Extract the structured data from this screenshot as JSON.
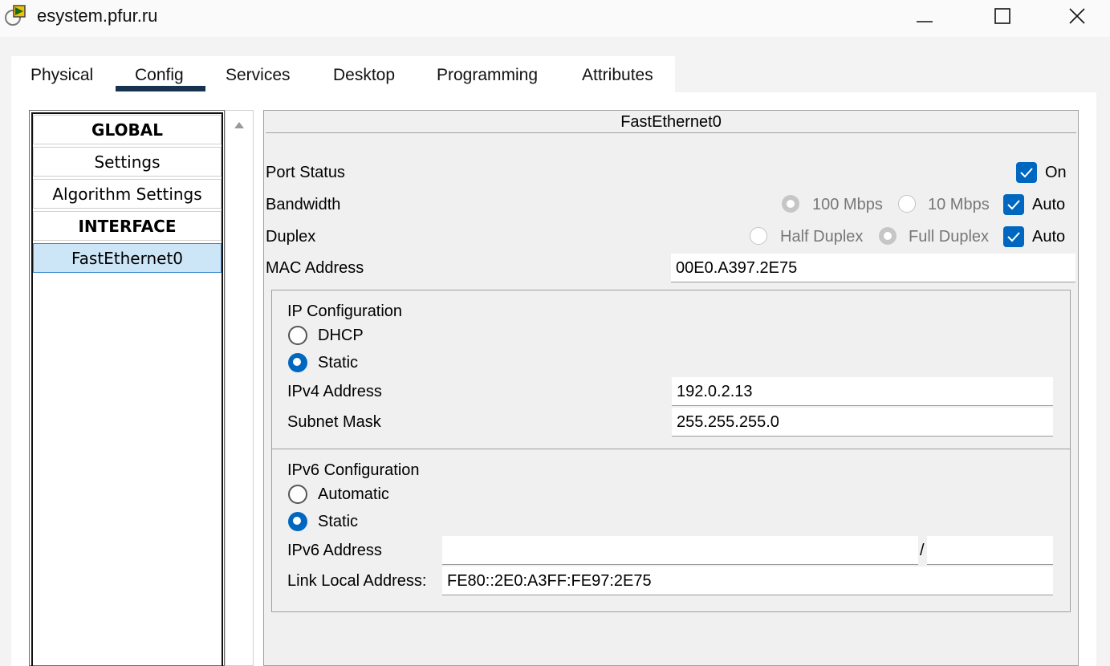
{
  "window": {
    "title": "esystem.pfur.ru"
  },
  "tabs": [
    "Physical",
    "Config",
    "Services",
    "Desktop",
    "Programming",
    "Attributes"
  ],
  "active_tab": "Config",
  "sidebar": {
    "items": [
      {
        "label": "GLOBAL",
        "type": "header"
      },
      {
        "label": "Settings",
        "type": "item"
      },
      {
        "label": "Algorithm Settings",
        "type": "item"
      },
      {
        "label": "INTERFACE",
        "type": "header"
      },
      {
        "label": "FastEthernet0",
        "type": "selected"
      }
    ]
  },
  "panel": {
    "title": "FastEthernet0",
    "port_status": {
      "label": "Port Status",
      "checkbox_label": "On",
      "checked": true
    },
    "bandwidth": {
      "label": "Bandwidth",
      "opt_100": "100 Mbps",
      "opt_10": "10 Mbps",
      "auto_label": "Auto",
      "auto_checked": true
    },
    "duplex": {
      "label": "Duplex",
      "half": "Half Duplex",
      "full": "Full Duplex",
      "auto_label": "Auto",
      "auto_checked": true
    },
    "mac": {
      "label": "MAC Address",
      "value": "00E0.A397.2E75"
    },
    "ipv4": {
      "title": "IP Configuration",
      "dhcp_label": "DHCP",
      "static_label": "Static",
      "mode": "Static",
      "address_label": "IPv4 Address",
      "address_value": "192.0.2.13",
      "mask_label": "Subnet Mask",
      "mask_value": "255.255.255.0"
    },
    "ipv6": {
      "title": "IPv6 Configuration",
      "auto_label": "Automatic",
      "static_label": "Static",
      "mode": "Static",
      "address_label": "IPv6 Address",
      "address_value": "",
      "prefix_separator": "/",
      "prefix_value": "",
      "link_local_label": "Link Local Address:",
      "link_local_value": "FE80::2E0:A3FF:FE97:2E75"
    }
  },
  "colors": {
    "accent": "#0067c0",
    "tab_underline": "#16324f",
    "selected_bg": "#cde6f7"
  }
}
